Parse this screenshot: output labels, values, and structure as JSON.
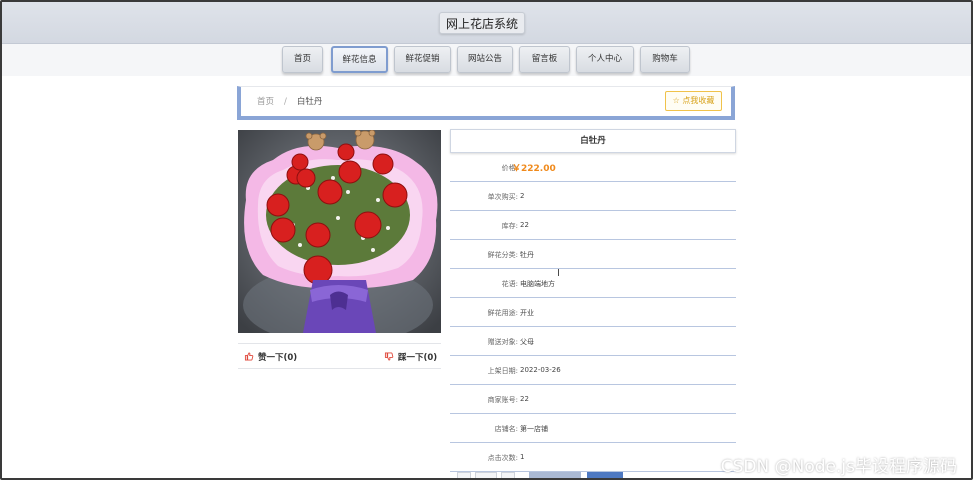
{
  "site": {
    "title": "网上花店系统"
  },
  "nav": [
    {
      "label": "首页",
      "active": false
    },
    {
      "label": "鲜花信息",
      "active": true
    },
    {
      "label": "鲜花促销",
      "active": false
    },
    {
      "label": "网站公告",
      "active": false
    },
    {
      "label": "留言板",
      "active": false
    },
    {
      "label": "个人中心",
      "active": false
    },
    {
      "label": "购物车",
      "active": false
    }
  ],
  "breadcrumb": {
    "home": "首页",
    "separator": "/",
    "current": "白牡丹"
  },
  "favorite_button": "☆ 点我收藏",
  "votes": {
    "like": "赞一下(0)",
    "dislike": "踩一下(0)"
  },
  "product": {
    "name": "白牡丹",
    "fields": [
      {
        "label": "价格:",
        "value": "￥222.00",
        "kind": "price"
      },
      {
        "label": "单次购买:",
        "value": "2"
      },
      {
        "label": "库存:",
        "value": "22"
      },
      {
        "label": "鲜花分类:",
        "value": "牡丹"
      },
      {
        "label": "花语:",
        "value": "电脑端地方"
      },
      {
        "label": "鲜花用途:",
        "value": "开业"
      },
      {
        "label": "赠送对象:",
        "value": "父母"
      },
      {
        "label": "上架日期:",
        "value": "2022-03-26"
      },
      {
        "label": "商家账号:",
        "value": "22"
      },
      {
        "label": "店铺名:",
        "value": "第一店铺"
      },
      {
        "label": "点击次数:",
        "value": "1"
      }
    ]
  },
  "watermark": "CSDN @Node.js毕设程序源码",
  "colors": {
    "accent": "#8aa5d6",
    "price": "#f08a1c",
    "favorite": "#d8a21a",
    "primary_button": "#4e79c2"
  }
}
